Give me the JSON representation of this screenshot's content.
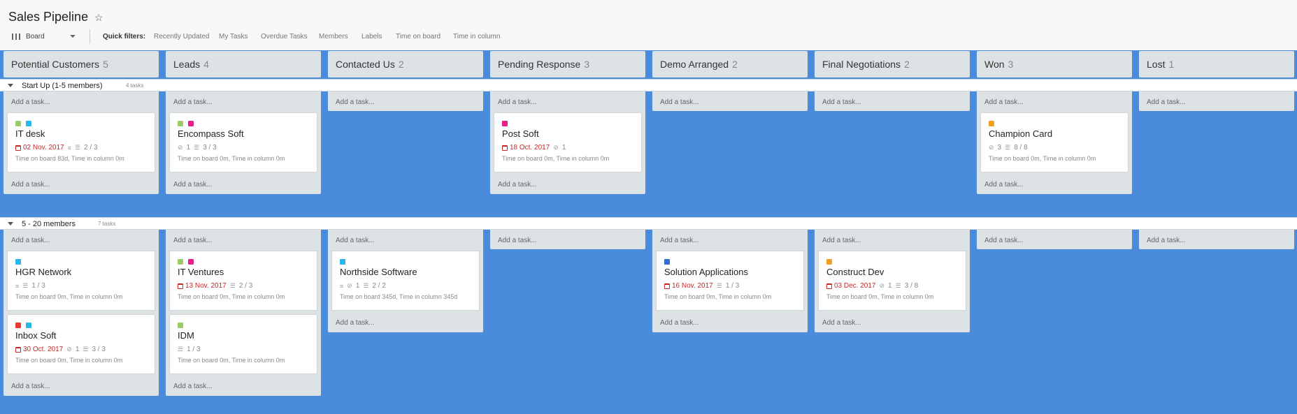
{
  "board": {
    "title": "Sales Pipeline",
    "view_label": "Board"
  },
  "quick_filters": {
    "label": "Quick filters:",
    "items": [
      "Recently Updated",
      "My Tasks",
      "Overdue Tasks",
      "Members",
      "Labels",
      "Time on board",
      "Time in column"
    ]
  },
  "add_task": "Add a task...",
  "columns": [
    {
      "name": "Potential Customers",
      "count": "5"
    },
    {
      "name": "Leads",
      "count": "4"
    },
    {
      "name": "Contacted Us",
      "count": "2"
    },
    {
      "name": "Pending Response",
      "count": "3"
    },
    {
      "name": "Demo Arranged",
      "count": "2"
    },
    {
      "name": "Final Negotiations",
      "count": "2"
    },
    {
      "name": "Won",
      "count": "3"
    },
    {
      "name": "Lost",
      "count": "1"
    }
  ],
  "swimlanes": [
    {
      "name": "Start Up (1-5 members)",
      "count_label": "4 tasks"
    },
    {
      "name": "5 - 20 members",
      "count_label": "7 tasks"
    }
  ],
  "label_colors": {
    "green": "#9ccc65",
    "cyan": "#29b6e8",
    "magenta": "#e91e8c",
    "orange": "#f0a020",
    "blue": "#2f6fd0",
    "red": "#e53935"
  },
  "cards": {
    "it_desk": {
      "name": "IT desk",
      "due": "02 Nov. 2017",
      "checklist": "2 / 3",
      "time": "Time on board 83d, Time in column 0m"
    },
    "encompass": {
      "name": "Encompass Soft",
      "attachments": "1",
      "checklist": "3 / 3",
      "time": "Time on board 0m, Time in column 0m"
    },
    "post_soft": {
      "name": "Post Soft",
      "due": "18 Oct. 2017",
      "attachments": "1",
      "time": "Time on board 0m, Time in column 0m"
    },
    "champion": {
      "name": "Champion Card",
      "attachments": "3",
      "checklist": "8 / 8",
      "time": "Time on board 0m, Time in column 0m"
    },
    "hgr": {
      "name": "HGR Network",
      "checklist": "1 / 3",
      "time": "Time on board 0m, Time in column 0m"
    },
    "inbox": {
      "name": "Inbox Soft",
      "due": "30 Oct. 2017",
      "attachments": "1",
      "checklist": "3 / 3",
      "time": "Time on board 0m, Time in column 0m"
    },
    "it_ventures": {
      "name": "IT Ventures",
      "due": "13 Nov. 2017",
      "checklist": "2 / 3",
      "time": "Time on board 0m, Time in column 0m"
    },
    "idm": {
      "name": "IDM",
      "checklist": "1 / 3",
      "time": "Time on board 0m, Time in column 0m"
    },
    "northside": {
      "name": "Northside Software",
      "attachments": "1",
      "checklist": "2 / 2",
      "time": "Time on board 345d, Time in column 345d"
    },
    "solution": {
      "name": "Solution Applications",
      "due": "16 Nov. 2017",
      "checklist": "1 / 3",
      "time": "Time on board 0m, Time in column 0m"
    },
    "construct": {
      "name": "Construct Dev",
      "due": "03 Dec. 2017",
      "attachments": "1",
      "checklist": "3 / 8",
      "time": "Time on board 0m, Time in column 0m"
    }
  }
}
